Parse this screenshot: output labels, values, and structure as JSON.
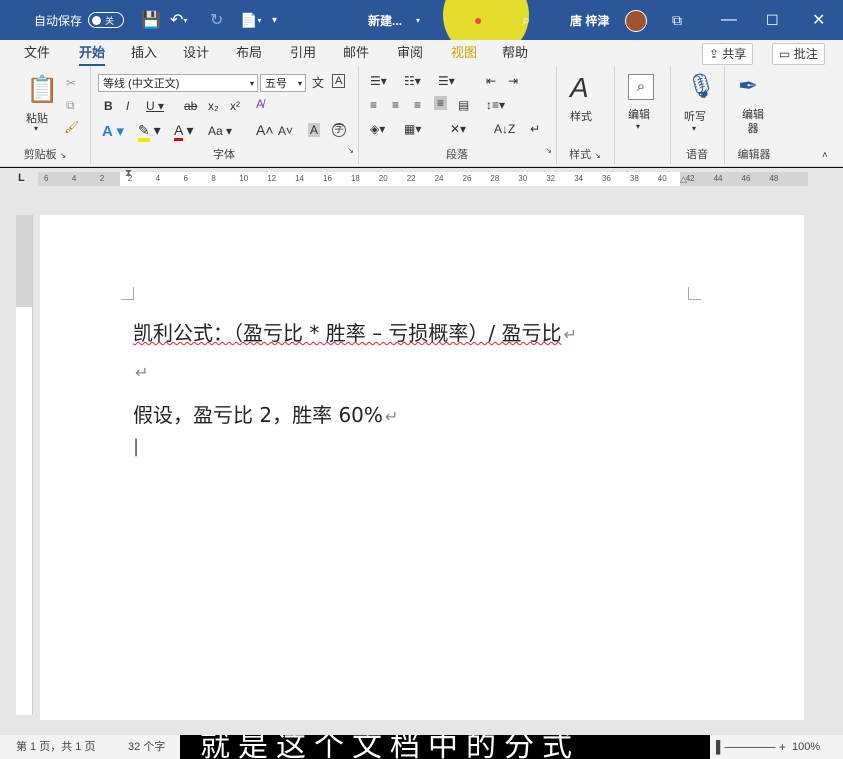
{
  "titlebar": {
    "autosave_label": "自动保存",
    "autosave_state": "关",
    "doc_title": "新建...",
    "user_name": "唐 梓津"
  },
  "tabs": [
    "文件",
    "开始",
    "插入",
    "设计",
    "布局",
    "引用",
    "邮件",
    "审阅",
    "视图",
    "帮助"
  ],
  "tabs_right": {
    "share": "共享",
    "comment": "批注"
  },
  "ribbon": {
    "clipboard": {
      "paste": "粘贴",
      "label": "剪贴板"
    },
    "font": {
      "name": "等线 (中文正文)",
      "size": "五号",
      "label": "字体"
    },
    "paragraph": {
      "label": "段落"
    },
    "styles": {
      "button": "样式",
      "label": "样式"
    },
    "editing": {
      "button": "编辑"
    },
    "voice": {
      "button": "听写",
      "label": "语音"
    },
    "editor": {
      "button": "编辑器",
      "label": "编辑器"
    }
  },
  "ruler": {
    "numbers": [
      "6",
      "4",
      "2",
      "2",
      "4",
      "6",
      "8",
      "10",
      "12",
      "14",
      "16",
      "18",
      "20",
      "22",
      "24",
      "26",
      "28",
      "30",
      "32",
      "34",
      "36",
      "38",
      "40",
      "42",
      "44",
      "46",
      "48"
    ]
  },
  "document": {
    "line1": "凯利公式：（盈亏比 * 胜率 – 亏损概率）/ 盈亏比",
    "line3": "假设，盈亏比 2，胜率 60%"
  },
  "statusbar": {
    "page": "第 1 页，共 1 页",
    "words": "32 个字",
    "zoom": "100%"
  },
  "subtitle": "就是这个文档中的分式"
}
